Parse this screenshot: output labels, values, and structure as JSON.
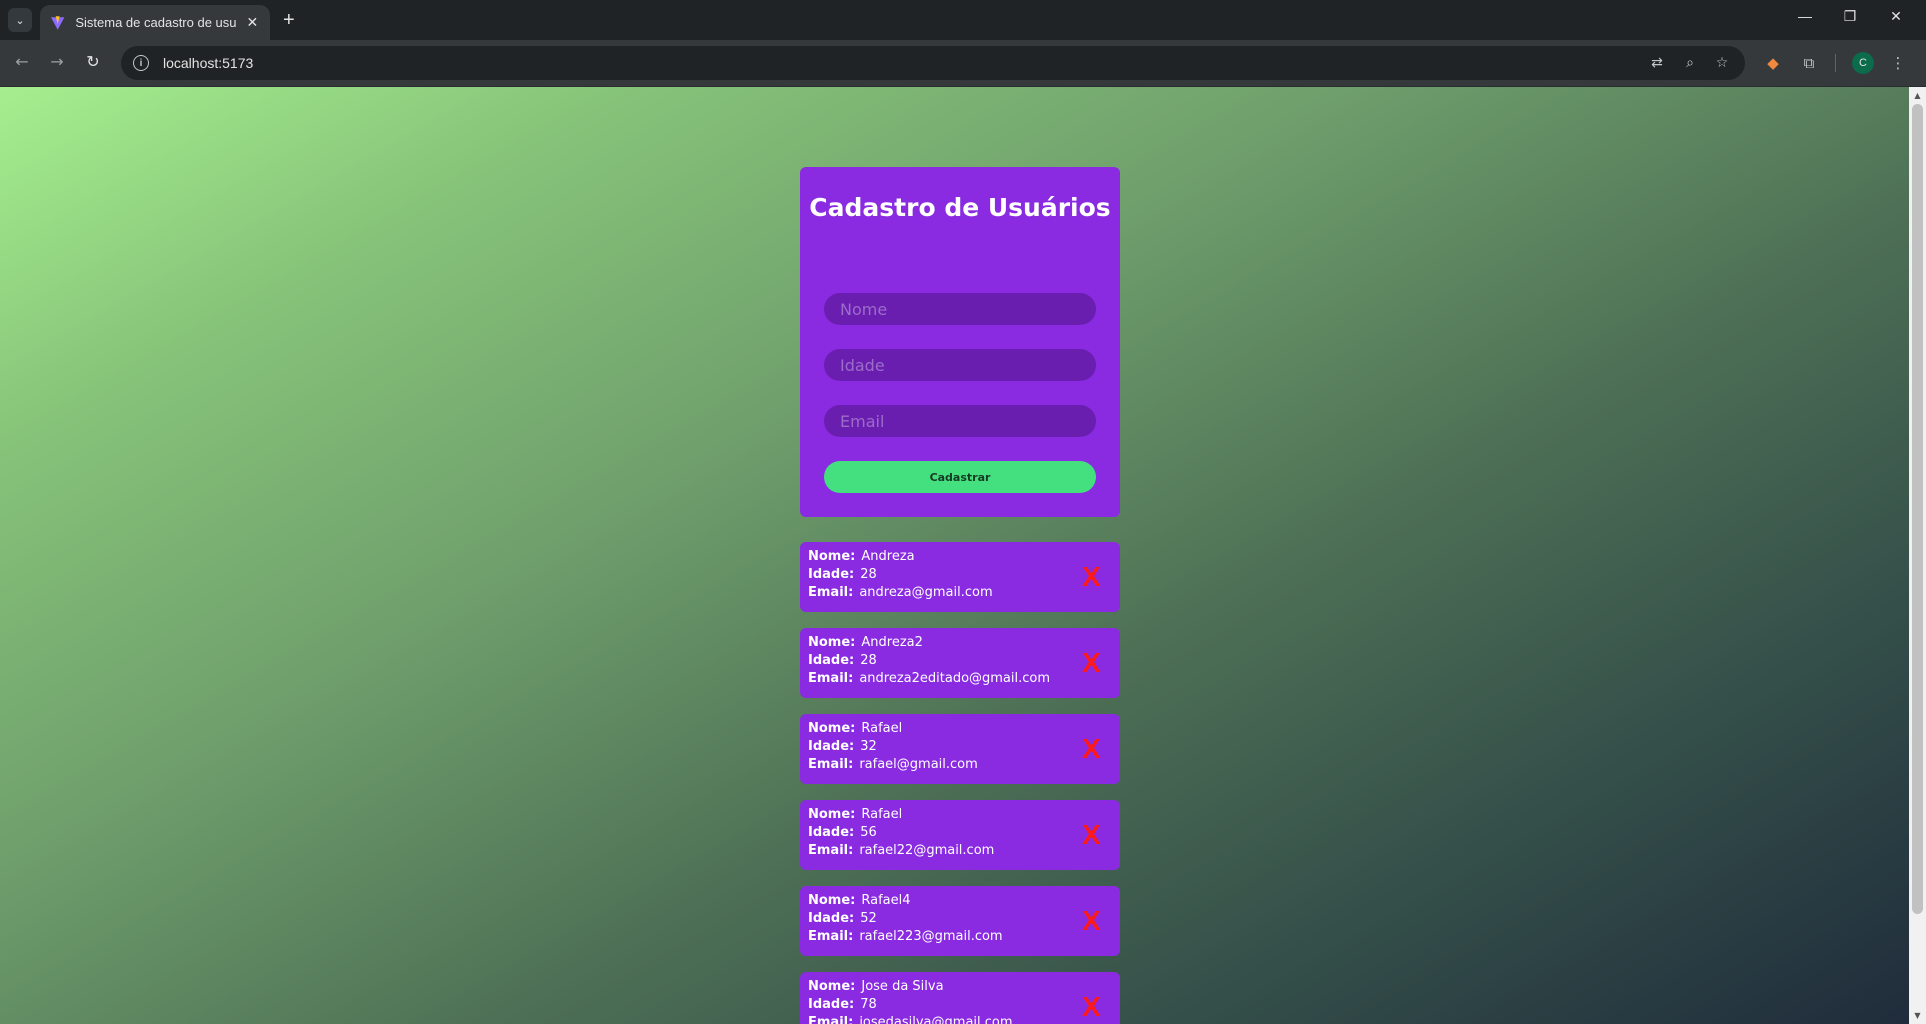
{
  "browser": {
    "tab_title": "Sistema de cadastro de usuarios",
    "tab_close": "✕",
    "new_tab": "+",
    "url": "localhost:5173",
    "profile_initial": "C",
    "window": {
      "minimize": "—",
      "restore": "❐",
      "close": "✕"
    },
    "icons": [
      "tab-search-icon",
      "back-icon",
      "forward-icon",
      "reload-icon",
      "info-icon",
      "translate-icon",
      "zoom-icon",
      "star-icon",
      "metamask-icon",
      "extensions-icon",
      "menu-icon"
    ]
  },
  "form": {
    "title": "Cadastro de Usuários",
    "name_placeholder": "Nome",
    "age_placeholder": "Idade",
    "email_placeholder": "Email",
    "submit_label": "Cadastrar"
  },
  "labels": {
    "name": "Nome:",
    "age": "Idade:",
    "email": "Email:",
    "delete": "X"
  },
  "users": [
    {
      "name": "Andreza",
      "age": "28",
      "email": "andreza@gmail.com"
    },
    {
      "name": "Andreza2",
      "age": "28",
      "email": "andreza2editado@gmail.com"
    },
    {
      "name": "Rafael",
      "age": "32",
      "email": "rafael@gmail.com"
    },
    {
      "name": "Rafael",
      "age": "56",
      "email": "rafael22@gmail.com"
    },
    {
      "name": "Rafael4",
      "age": "52",
      "email": "rafael223@gmail.com"
    },
    {
      "name": "Jose da Silva",
      "age": "78",
      "email": "josedasilva@gmail.com"
    }
  ],
  "colors": {
    "card": "#8a2be2",
    "input": "#6a1eb0",
    "button": "#44e07f",
    "delete": "#ff1a1a",
    "gradient_start": "#a5ee8e",
    "gradient_end": "#1f2b3b"
  }
}
